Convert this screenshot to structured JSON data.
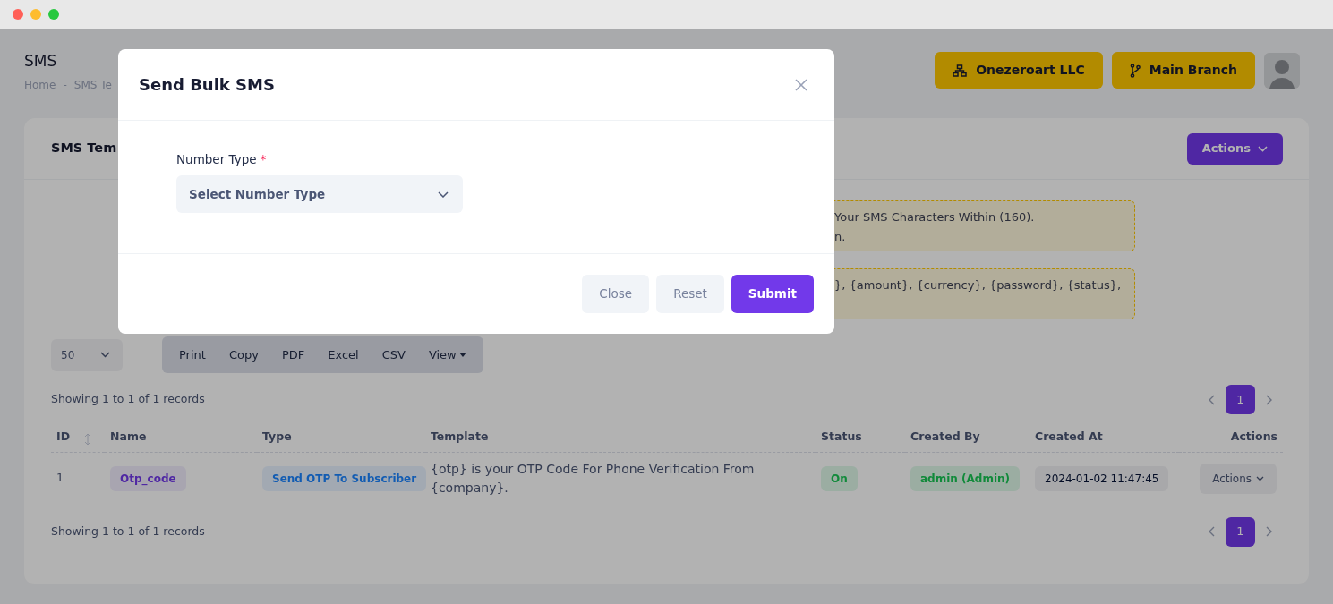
{
  "window": {
    "controls": [
      {
        "color": "#ff5f57"
      },
      {
        "color": "#febc2e"
      },
      {
        "color": "#28c840"
      }
    ]
  },
  "header": {
    "title": "SMS",
    "breadcrumb": [
      "Home",
      "-",
      "SMS Te"
    ],
    "company_button": "Onezeroart LLC",
    "branch_button": "Main Branch"
  },
  "card": {
    "title": "SMS Tem",
    "actions_button": "Actions",
    "notices": [
      {
        "lines": [
          "Your SMS Characters Within (160).",
          "n."
        ]
      },
      {
        "lines": [
          "}, {amount}, {currency}, {password}, {status},"
        ]
      }
    ],
    "page_length": "50",
    "export_buttons": [
      {
        "label": "Print",
        "kind": "plain"
      },
      {
        "label": "Copy",
        "kind": "plain"
      },
      {
        "label": "PDF",
        "kind": "plain"
      },
      {
        "label": "Excel",
        "kind": "plain"
      },
      {
        "label": "CSV",
        "kind": "plain"
      },
      {
        "label": "View",
        "kind": "dropdown"
      }
    ],
    "info_top": "Showing 1 to 1 of 1 records",
    "pagination_top": [
      {
        "label": "1",
        "selected": true
      }
    ],
    "table": {
      "columns": [
        {
          "label": "ID",
          "sortable": true
        },
        {
          "label": "Name",
          "sortable": false
        },
        {
          "label": "Type",
          "sortable": false
        },
        {
          "label": "Template",
          "sortable": false
        },
        {
          "label": "Status",
          "sortable": false
        },
        {
          "label": "Created By",
          "sortable": false
        },
        {
          "label": "Created At",
          "sortable": false
        },
        {
          "label": "Actions",
          "sortable": false
        }
      ],
      "rows": [
        {
          "id": "1",
          "name": "Otp_code",
          "type": "Send OTP To Subscriber",
          "template": "{otp} is your OTP Code For Phone Verification From {company}.",
          "status": "On",
          "created_by": "admin (Admin)",
          "created_at": "2024-01-02 11:47:45",
          "actions": "Actions"
        }
      ]
    },
    "info_bottom": "Showing 1 to 1 of 1 records",
    "pagination_bottom": [
      {
        "label": "1",
        "selected": true
      }
    ]
  },
  "modal": {
    "title": "Send Bulk SMS",
    "field": {
      "label": "Number Type",
      "required_mark": "*",
      "placeholder": "Select Number Type"
    },
    "buttons": [
      {
        "label": "Close",
        "kind": "secondary"
      },
      {
        "label": "Reset",
        "kind": "secondary"
      },
      {
        "label": "Submit",
        "kind": "primary"
      }
    ]
  }
}
